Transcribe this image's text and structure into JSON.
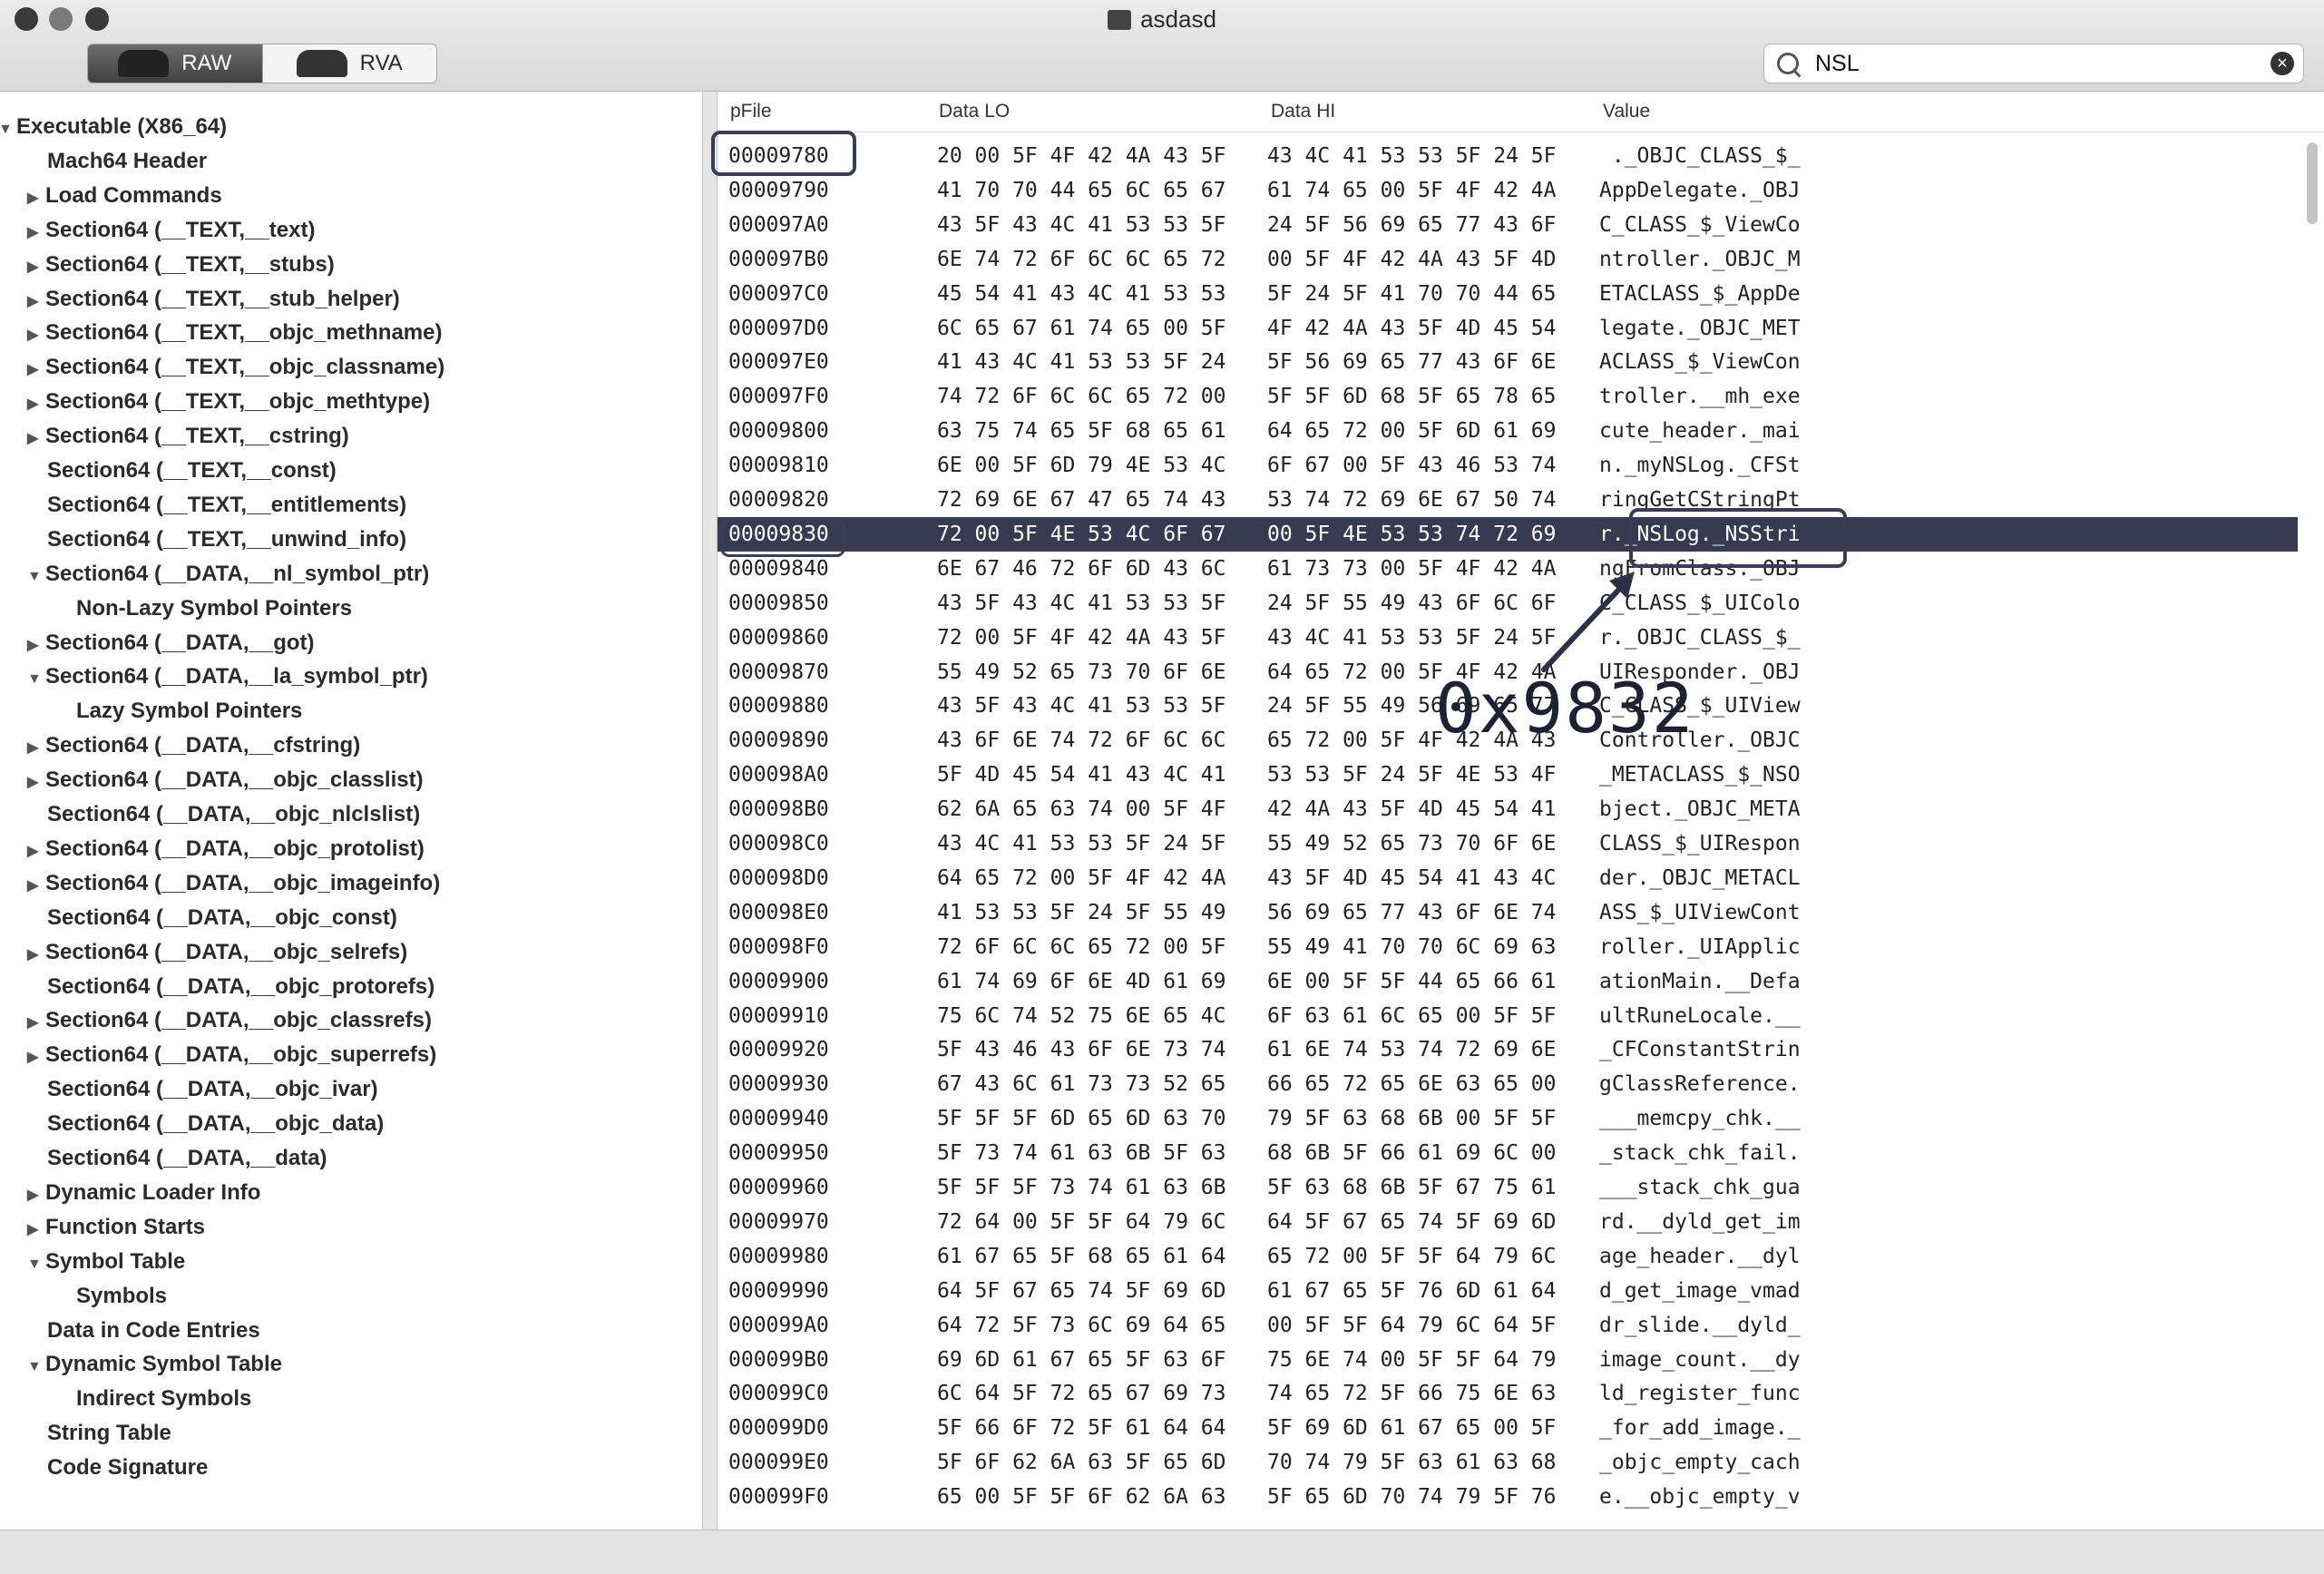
{
  "window": {
    "title": "asdasd"
  },
  "toolbar": {
    "raw_label": "RAW",
    "rva_label": "RVA",
    "search_value": "NSL"
  },
  "sidebar": {
    "items": [
      {
        "label": "Executable  (X86_64)",
        "level": 0,
        "disc": "open"
      },
      {
        "label": "Mach64 Header",
        "level": 1,
        "disc": "none"
      },
      {
        "label": "Load Commands",
        "level": 1,
        "disc": "closed"
      },
      {
        "label": "Section64 (__TEXT,__text)",
        "level": 1,
        "disc": "closed"
      },
      {
        "label": "Section64 (__TEXT,__stubs)",
        "level": 1,
        "disc": "closed"
      },
      {
        "label": "Section64 (__TEXT,__stub_helper)",
        "level": 1,
        "disc": "closed"
      },
      {
        "label": "Section64 (__TEXT,__objc_methname)",
        "level": 1,
        "disc": "closed"
      },
      {
        "label": "Section64 (__TEXT,__objc_classname)",
        "level": 1,
        "disc": "closed"
      },
      {
        "label": "Section64 (__TEXT,__objc_methtype)",
        "level": 1,
        "disc": "closed"
      },
      {
        "label": "Section64 (__TEXT,__cstring)",
        "level": 1,
        "disc": "closed"
      },
      {
        "label": "Section64 (__TEXT,__const)",
        "level": 1,
        "disc": "none"
      },
      {
        "label": "Section64 (__TEXT,__entitlements)",
        "level": 1,
        "disc": "none"
      },
      {
        "label": "Section64 (__TEXT,__unwind_info)",
        "level": 1,
        "disc": "none"
      },
      {
        "label": "Section64 (__DATA,__nl_symbol_ptr)",
        "level": 1,
        "disc": "open"
      },
      {
        "label": "Non-Lazy Symbol Pointers",
        "level": 2,
        "disc": "none"
      },
      {
        "label": "Section64 (__DATA,__got)",
        "level": 1,
        "disc": "closed"
      },
      {
        "label": "Section64 (__DATA,__la_symbol_ptr)",
        "level": 1,
        "disc": "open"
      },
      {
        "label": "Lazy Symbol Pointers",
        "level": 2,
        "disc": "none"
      },
      {
        "label": "Section64 (__DATA,__cfstring)",
        "level": 1,
        "disc": "closed"
      },
      {
        "label": "Section64 (__DATA,__objc_classlist)",
        "level": 1,
        "disc": "closed"
      },
      {
        "label": "Section64 (__DATA,__objc_nlclslist)",
        "level": 1,
        "disc": "none"
      },
      {
        "label": "Section64 (__DATA,__objc_protolist)",
        "level": 1,
        "disc": "closed"
      },
      {
        "label": "Section64 (__DATA,__objc_imageinfo)",
        "level": 1,
        "disc": "closed"
      },
      {
        "label": "Section64 (__DATA,__objc_const)",
        "level": 1,
        "disc": "none"
      },
      {
        "label": "Section64 (__DATA,__objc_selrefs)",
        "level": 1,
        "disc": "closed"
      },
      {
        "label": "Section64 (__DATA,__objc_protorefs)",
        "level": 1,
        "disc": "none"
      },
      {
        "label": "Section64 (__DATA,__objc_classrefs)",
        "level": 1,
        "disc": "closed"
      },
      {
        "label": "Section64 (__DATA,__objc_superrefs)",
        "level": 1,
        "disc": "closed"
      },
      {
        "label": "Section64 (__DATA,__objc_ivar)",
        "level": 1,
        "disc": "none"
      },
      {
        "label": "Section64 (__DATA,__objc_data)",
        "level": 1,
        "disc": "none"
      },
      {
        "label": "Section64 (__DATA,__data)",
        "level": 1,
        "disc": "none"
      },
      {
        "label": "Dynamic Loader Info",
        "level": 1,
        "disc": "closed"
      },
      {
        "label": "Function Starts",
        "level": 1,
        "disc": "closed"
      },
      {
        "label": "Symbol Table",
        "level": 1,
        "disc": "open"
      },
      {
        "label": "Symbols",
        "level": 2,
        "disc": "none"
      },
      {
        "label": "Data in Code Entries",
        "level": 1,
        "disc": "none"
      },
      {
        "label": "Dynamic Symbol Table",
        "level": 1,
        "disc": "open"
      },
      {
        "label": "Indirect Symbols",
        "level": 2,
        "disc": "none"
      },
      {
        "label": "String Table",
        "level": 1,
        "disc": "none"
      },
      {
        "label": "Code Signature",
        "level": 1,
        "disc": "none"
      }
    ]
  },
  "hex": {
    "headers": {
      "pfile": "pFile",
      "lo": "Data LO",
      "hi": "Data HI",
      "value": "Value"
    },
    "selected_offset": "00009830",
    "rows": [
      [
        "00009780",
        "20 00 5F 4F 42 4A 43 5F",
        "43 4C 41 53 53 5F 24 5F",
        " ._OBJC_CLASS_$_"
      ],
      [
        "00009790",
        "41 70 70 44 65 6C 65 67",
        "61 74 65 00 5F 4F 42 4A",
        "AppDelegate._OBJ"
      ],
      [
        "000097A0",
        "43 5F 43 4C 41 53 53 5F",
        "24 5F 56 69 65 77 43 6F",
        "C_CLASS_$_ViewCo"
      ],
      [
        "000097B0",
        "6E 74 72 6F 6C 6C 65 72",
        "00 5F 4F 42 4A 43 5F 4D",
        "ntroller._OBJC_M"
      ],
      [
        "000097C0",
        "45 54 41 43 4C 41 53 53",
        "5F 24 5F 41 70 70 44 65",
        "ETACLASS_$_AppDe"
      ],
      [
        "000097D0",
        "6C 65 67 61 74 65 00 5F",
        "4F 42 4A 43 5F 4D 45 54",
        "legate._OBJC_MET"
      ],
      [
        "000097E0",
        "41 43 4C 41 53 53 5F 24",
        "5F 56 69 65 77 43 6F 6E",
        "ACLASS_$_ViewCon"
      ],
      [
        "000097F0",
        "74 72 6F 6C 6C 65 72 00",
        "5F 5F 6D 68 5F 65 78 65",
        "troller.__mh_exe"
      ],
      [
        "00009800",
        "63 75 74 65 5F 68 65 61",
        "64 65 72 00 5F 6D 61 69",
        "cute_header._mai"
      ],
      [
        "00009810",
        "6E 00 5F 6D 79 4E 53 4C",
        "6F 67 00 5F 43 46 53 74",
        "n._myNSLog._CFSt"
      ],
      [
        "00009820",
        "72 69 6E 67 47 65 74 43",
        "53 74 72 69 6E 67 50 74",
        "ringGetCStringPt"
      ],
      [
        "00009830",
        "72 00 5F 4E 53 4C 6F 67",
        "00 5F 4E 53 53 74 72 69",
        "r._NSLog._NSStri"
      ],
      [
        "00009840",
        "6E 67 46 72 6F 6D 43 6C",
        "61 73 73 00 5F 4F 42 4A",
        "ngFromClass._OBJ"
      ],
      [
        "00009850",
        "43 5F 43 4C 41 53 53 5F",
        "24 5F 55 49 43 6F 6C 6F",
        "C_CLASS_$_UIColo"
      ],
      [
        "00009860",
        "72 00 5F 4F 42 4A 43 5F",
        "43 4C 41 53 53 5F 24 5F",
        "r._OBJC_CLASS_$_"
      ],
      [
        "00009870",
        "55 49 52 65 73 70 6F 6E",
        "64 65 72 00 5F 4F 42 4A",
        "UIResponder._OBJ"
      ],
      [
        "00009880",
        "43 5F 43 4C 41 53 53 5F",
        "24 5F 55 49 56 69 65 77",
        "C_CLASS_$_UIView"
      ],
      [
        "00009890",
        "43 6F 6E 74 72 6F 6C 6C",
        "65 72 00 5F 4F 42 4A 43",
        "Controller._OBJC"
      ],
      [
        "000098A0",
        "5F 4D 45 54 41 43 4C 41",
        "53 53 5F 24 5F 4E 53 4F",
        "_METACLASS_$_NSO"
      ],
      [
        "000098B0",
        "62 6A 65 63 74 00 5F 4F",
        "42 4A 43 5F 4D 45 54 41",
        "bject._OBJC_META"
      ],
      [
        "000098C0",
        "43 4C 41 53 53 5F 24 5F",
        "55 49 52 65 73 70 6F 6E",
        "CLASS_$_UIRespon"
      ],
      [
        "000098D0",
        "64 65 72 00 5F 4F 42 4A",
        "43 5F 4D 45 54 41 43 4C",
        "der._OBJC_METACL"
      ],
      [
        "000098E0",
        "41 53 53 5F 24 5F 55 49",
        "56 69 65 77 43 6F 6E 74",
        "ASS_$_UIViewCont"
      ],
      [
        "000098F0",
        "72 6F 6C 6C 65 72 00 5F",
        "55 49 41 70 70 6C 69 63",
        "roller._UIApplic"
      ],
      [
        "00009900",
        "61 74 69 6F 6E 4D 61 69",
        "6E 00 5F 5F 44 65 66 61",
        "ationMain.__Defa"
      ],
      [
        "00009910",
        "75 6C 74 52 75 6E 65 4C",
        "6F 63 61 6C 65 00 5F 5F",
        "ultRuneLocale.__"
      ],
      [
        "00009920",
        "5F 43 46 43 6F 6E 73 74",
        "61 6E 74 53 74 72 69 6E",
        "_CFConstantStrin"
      ],
      [
        "00009930",
        "67 43 6C 61 73 73 52 65",
        "66 65 72 65 6E 63 65 00",
        "gClassReference."
      ],
      [
        "00009940",
        "5F 5F 5F 6D 65 6D 63 70",
        "79 5F 63 68 6B 00 5F 5F",
        "___memcpy_chk.__"
      ],
      [
        "00009950",
        "5F 73 74 61 63 6B 5F 63",
        "68 6B 5F 66 61 69 6C 00",
        "_stack_chk_fail."
      ],
      [
        "00009960",
        "5F 5F 5F 73 74 61 63 6B",
        "5F 63 68 6B 5F 67 75 61",
        "___stack_chk_gua"
      ],
      [
        "00009970",
        "72 64 00 5F 5F 64 79 6C",
        "64 5F 67 65 74 5F 69 6D",
        "rd.__dyld_get_im"
      ],
      [
        "00009980",
        "61 67 65 5F 68 65 61 64",
        "65 72 00 5F 5F 64 79 6C",
        "age_header.__dyl"
      ],
      [
        "00009990",
        "64 5F 67 65 74 5F 69 6D",
        "61 67 65 5F 76 6D 61 64",
        "d_get_image_vmad"
      ],
      [
        "000099A0",
        "64 72 5F 73 6C 69 64 65",
        "00 5F 5F 64 79 6C 64 5F",
        "dr_slide.__dyld_"
      ],
      [
        "000099B0",
        "69 6D 61 67 65 5F 63 6F",
        "75 6E 74 00 5F 5F 64 79",
        "image_count.__dy"
      ],
      [
        "000099C0",
        "6C 64 5F 72 65 67 69 73",
        "74 65 72 5F 66 75 6E 63",
        "ld_register_func"
      ],
      [
        "000099D0",
        "5F 66 6F 72 5F 61 64 64",
        "5F 69 6D 61 67 65 00 5F",
        "_for_add_image._"
      ],
      [
        "000099E0",
        "5F 6F 62 6A 63 5F 65 6D",
        "70 74 79 5F 63 61 63 68",
        "_objc_empty_cach"
      ],
      [
        "000099F0",
        "65 00 5F 5F 6F 62 6A 63",
        "5F 65 6D 70 74 79 5F 76",
        "e.__objc_empty_v"
      ]
    ]
  },
  "annotation": {
    "text": "0x9832",
    "color": "#1e2033"
  }
}
